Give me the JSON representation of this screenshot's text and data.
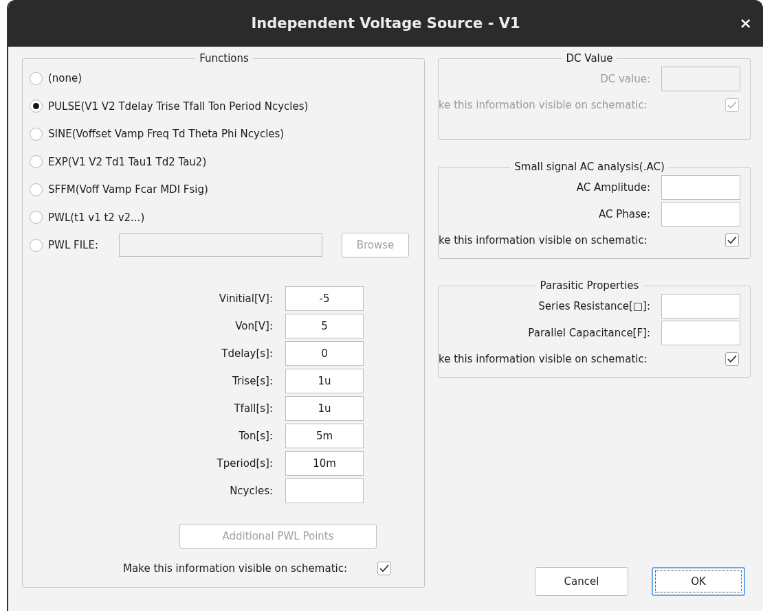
{
  "window": {
    "title": "Independent Voltage Source - V1",
    "close": "×"
  },
  "functions": {
    "title": "Functions",
    "options": [
      {
        "kind": "radio",
        "label": "(none)",
        "selected": false
      },
      {
        "kind": "radio",
        "label": "PULSE(V1 V2 Tdelay Trise Tfall Ton Period Ncycles)",
        "selected": true
      },
      {
        "kind": "radio",
        "label": "SINE(Voffset Vamp Freq Td Theta Phi Ncycles)",
        "selected": false
      },
      {
        "kind": "radio",
        "label": "EXP(V1 V2 Td1 Tau1 Td2 Tau2)",
        "selected": false
      },
      {
        "kind": "radio",
        "label": "SFFM(Voff Vamp Fcar MDI Fsig)",
        "selected": false
      },
      {
        "kind": "radio",
        "label": "PWL(t1 v1 t2 v2...)",
        "selected": false
      },
      {
        "kind": "file",
        "label": "PWL FILE:",
        "selected": false,
        "disabled": true,
        "browse": {
          "label": "Browse",
          "disabled": true
        }
      }
    ],
    "parameters": [
      {
        "label": "Vinitial[V]:",
        "value": "-5"
      },
      {
        "label": "Von[V]:",
        "value": "5"
      },
      {
        "label": "Tdelay[s]:",
        "value": "0"
      },
      {
        "label": "Trise[s]:",
        "value": "1u"
      },
      {
        "label": "Tfall[s]:",
        "value": "1u"
      },
      {
        "label": "Ton[s]:",
        "value": "5m"
      },
      {
        "label": "Tperiod[s]:",
        "value": "10m"
      },
      {
        "label": "Ncycles:"
      }
    ],
    "pwl_points_button": {
      "label": "Additional PWL Points",
      "disabled": true
    },
    "visible": {
      "label": "Make this information visible on schematic:",
      "checked": true
    }
  },
  "groups": [
    {
      "title": "DC Value",
      "disabled": true,
      "fields": [
        {
          "label": "DC value:"
        }
      ],
      "visible": {
        "label": "ke this information visible on schematic:",
        "checked": true
      }
    },
    {
      "title": "Small signal AC analysis(.AC)",
      "disabled": false,
      "fields": [
        {
          "label": "AC Amplitude:"
        },
        {
          "label": "AC Phase:"
        }
      ],
      "visible": {
        "label": "ke this information visible on schematic:",
        "checked": true
      }
    },
    {
      "title": "Parasitic Properties",
      "disabled": false,
      "fields": [
        {
          "label": "Series Resistance[□]:"
        },
        {
          "label": "Parallel Capacitance[F]:"
        }
      ],
      "visible": {
        "label": "ke this information visible on schematic:",
        "checked": true
      }
    }
  ],
  "buttons": [
    {
      "label": "Cancel",
      "focused": false
    },
    {
      "label": "OK",
      "focused": true
    }
  ]
}
